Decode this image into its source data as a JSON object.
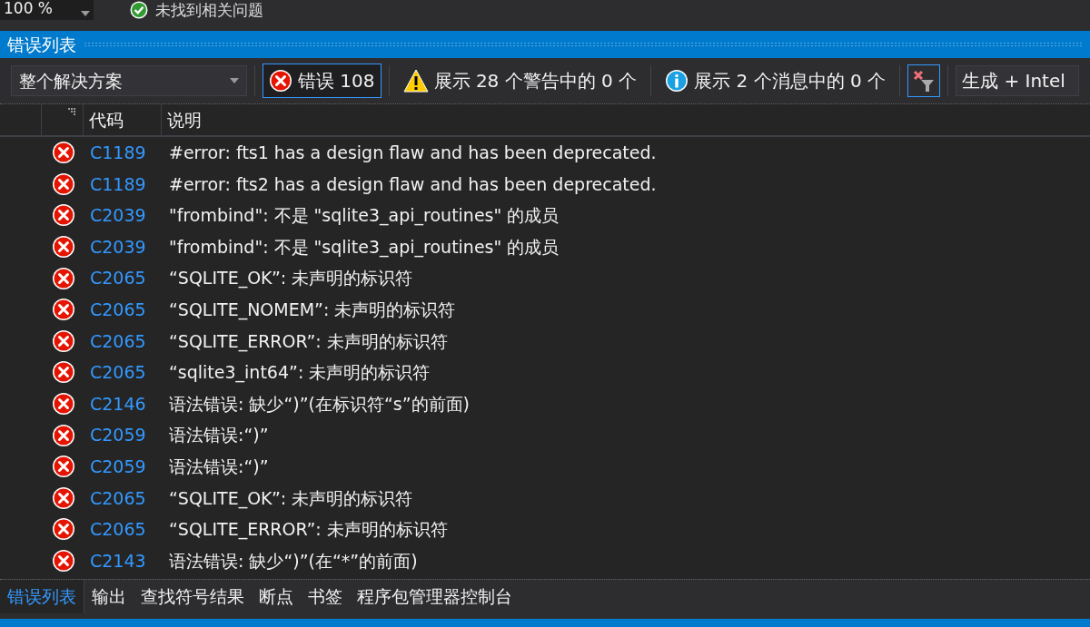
{
  "top_bar": {
    "zoom": "100 %",
    "status": "未找到相关问题"
  },
  "panel": {
    "title": "错误列表"
  },
  "toolbar": {
    "scope": "整个解决方案",
    "filters": [
      {
        "kind": "error",
        "label": "错误 108",
        "selected": true
      },
      {
        "kind": "warning",
        "label": "展示 28 个警告中的 0 个",
        "selected": false
      },
      {
        "kind": "info",
        "label": "展示 2 个消息中的 0 个",
        "selected": false
      }
    ],
    "clear_filter": {
      "selected": true
    },
    "source": "生成 + Intel"
  },
  "table": {
    "columns": [
      "代码",
      "说明"
    ],
    "rows": [
      {
        "code": "C1189",
        "description": "#error:  fts1 has a design flaw and has been deprecated."
      },
      {
        "code": "C1189",
        "description": "#error:  fts2 has a design flaw and has been deprecated."
      },
      {
        "code": "C2039",
        "description": "\"frombind\": 不是 \"sqlite3_api_routines\" 的成员"
      },
      {
        "code": "C2039",
        "description": "\"frombind\": 不是 \"sqlite3_api_routines\" 的成员"
      },
      {
        "code": "C2065",
        "description": "“SQLITE_OK”: 未声明的标识符"
      },
      {
        "code": "C2065",
        "description": "“SQLITE_NOMEM”: 未声明的标识符"
      },
      {
        "code": "C2065",
        "description": "“SQLITE_ERROR”: 未声明的标识符"
      },
      {
        "code": "C2065",
        "description": "“sqlite3_int64”: 未声明的标识符"
      },
      {
        "code": "C2146",
        "description": "语法错误: 缺少“)”(在标识符“s”的前面)"
      },
      {
        "code": "C2059",
        "description": "语法错误:“)”"
      },
      {
        "code": "C2059",
        "description": "语法错误:“)”"
      },
      {
        "code": "C2065",
        "description": "“SQLITE_OK”: 未声明的标识符"
      },
      {
        "code": "C2065",
        "description": "“SQLITE_ERROR”: 未声明的标识符"
      },
      {
        "code": "C2143",
        "description": "语法错误: 缺少“)”(在“*”的前面)"
      }
    ]
  },
  "bottom_tabs": [
    {
      "label": "错误列表",
      "selected": true
    },
    {
      "label": "输出",
      "selected": false
    },
    {
      "label": "查找符号结果",
      "selected": false
    },
    {
      "label": "断点",
      "selected": false
    },
    {
      "label": "书签",
      "selected": false
    },
    {
      "label": "程序包管理器控制台",
      "selected": false
    }
  ]
}
